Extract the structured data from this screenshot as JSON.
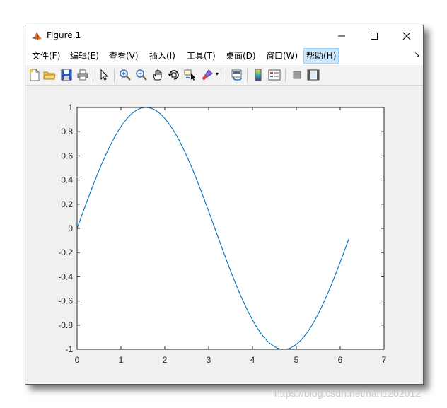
{
  "window": {
    "title": "Figure 1",
    "controls": {
      "minimize": "minimize",
      "maximize": "maximize",
      "close": "close"
    }
  },
  "menu": {
    "items": [
      {
        "label": "文件(F)",
        "name": "file"
      },
      {
        "label": "编辑(E)",
        "name": "edit"
      },
      {
        "label": "查看(V)",
        "name": "view"
      },
      {
        "label": "插入(I)",
        "name": "insert"
      },
      {
        "label": "工具(T)",
        "name": "tools"
      },
      {
        "label": "桌面(D)",
        "name": "desktop"
      },
      {
        "label": "窗口(W)",
        "name": "window"
      },
      {
        "label": "帮助(H)",
        "name": "help",
        "active": true
      }
    ],
    "arrow": "↘"
  },
  "toolbar": {
    "icons": [
      "new-figure-icon",
      "open-file-icon",
      "save-icon",
      "print-icon",
      "edit-plot-arrow-icon",
      "zoom-in-icon",
      "zoom-out-icon",
      "pan-hand-icon",
      "rotate-3d-icon",
      "data-cursor-icon",
      "brush-icon",
      "link-plot-icon",
      "colorbar-icon",
      "legend-icon",
      "hide-plot-tools-icon",
      "show-plot-tools-icon"
    ]
  },
  "chart_data": {
    "type": "line",
    "function": "sin(x)",
    "x": [
      0,
      0.2,
      0.4,
      0.6,
      0.8,
      1.0,
      1.2,
      1.4,
      1.6,
      1.8,
      2.0,
      2.2,
      2.4,
      2.6,
      2.8,
      3.0,
      3.2,
      3.4,
      3.6,
      3.8,
      4.0,
      4.2,
      4.4,
      4.6,
      4.8,
      5.0,
      5.2,
      5.4,
      5.6,
      5.8,
      6.0,
      6.2
    ],
    "y": [
      0,
      0.199,
      0.389,
      0.565,
      0.717,
      0.841,
      0.932,
      0.985,
      1.0,
      0.974,
      0.909,
      0.808,
      0.675,
      0.516,
      0.335,
      0.141,
      -0.058,
      -0.256,
      -0.443,
      -0.612,
      -0.757,
      -0.872,
      -0.952,
      -0.994,
      -0.996,
      -0.959,
      -0.883,
      -0.773,
      -0.631,
      -0.465,
      -0.279,
      -0.083
    ],
    "xlim": [
      0,
      7
    ],
    "ylim": [
      -1,
      1
    ],
    "xticks": [
      "0",
      "1",
      "2",
      "3",
      "4",
      "5",
      "6",
      "7"
    ],
    "yticks": [
      "-1",
      "-0.8",
      "-0.6",
      "-0.4",
      "-0.2",
      "0",
      "0.2",
      "0.4",
      "0.6",
      "0.8",
      "1"
    ],
    "line_color": "#0072BD",
    "grid": false,
    "title": "",
    "xlabel": "",
    "ylabel": ""
  },
  "watermark": "https://blog.csdn.net/han1202012"
}
